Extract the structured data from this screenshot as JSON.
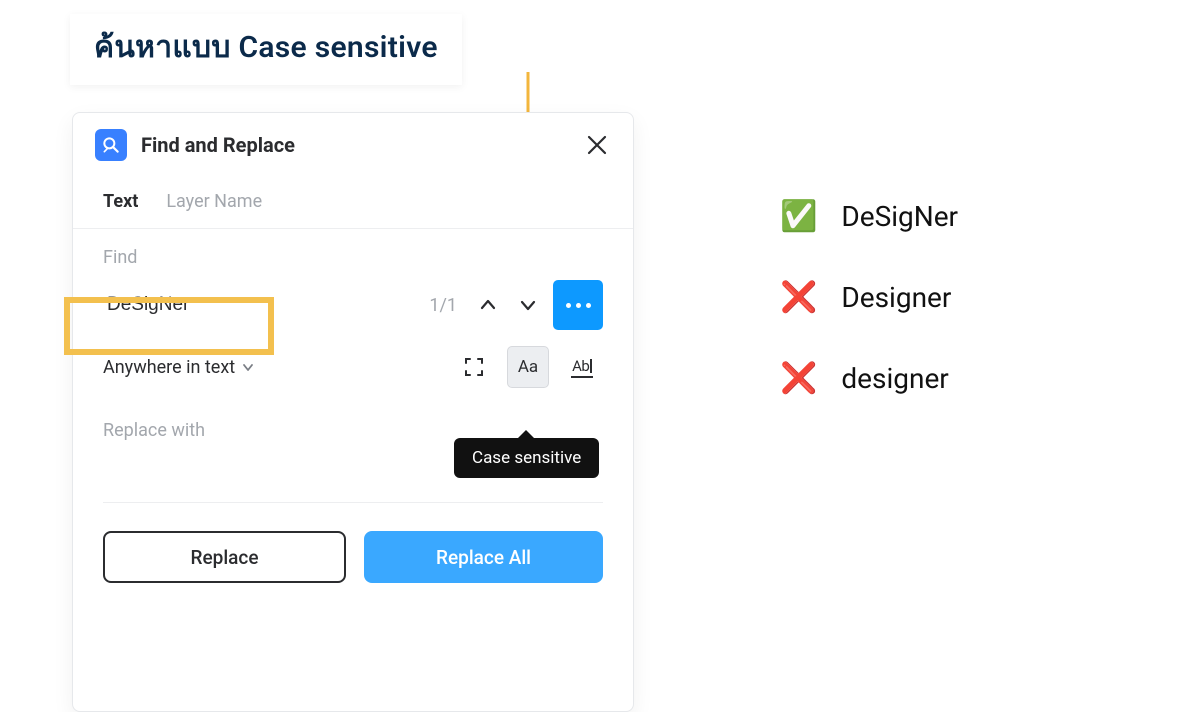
{
  "callout_title": "ค้นหาแบบ Case sensitive",
  "dialog": {
    "title": "Find and Replace",
    "tabs": {
      "text": "Text",
      "layer": "Layer Name"
    },
    "find_label": "Find",
    "find_value": "DeSigNer",
    "match_count": "1/1",
    "scope_label": "Anywhere in text",
    "tooltip": "Case sensitive",
    "replace_label": "Replace with",
    "replace_btn": "Replace",
    "replace_all_btn": "Replace All",
    "toggles": {
      "case_sensitive_glyph": "Aa",
      "whole_word_glyph": "Ab"
    }
  },
  "results": [
    {
      "icon": "✅",
      "text": "DeSigNer"
    },
    {
      "icon": "❌",
      "text": "Designer"
    },
    {
      "icon": "❌",
      "text": "designer"
    }
  ]
}
